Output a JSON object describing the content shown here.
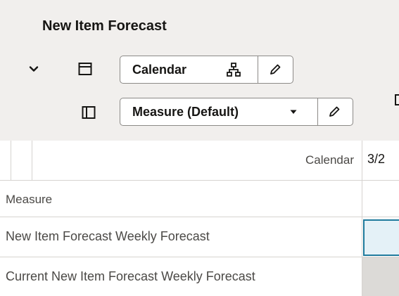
{
  "header": {
    "title": "New Item Forecast"
  },
  "pivot": {
    "column_chip": {
      "label": "Calendar"
    },
    "row_chip": {
      "label": "Measure (Default)"
    }
  },
  "grid": {
    "column_dimension_label": "Calendar",
    "first_column_header": "3/2",
    "row_dimension_label": "Measure",
    "rows": [
      {
        "label": "New Item Forecast Weekly Forecast"
      },
      {
        "label": "Current New Item Forecast Weekly Forecast"
      }
    ]
  },
  "colors": {
    "header_bg": "#f1efed",
    "grid_line": "#d6d3d0",
    "selected_cell_bg": "#e4f1f7",
    "selected_cell_border": "#1f7a9c",
    "readonly_cell_bg": "#dcdad7"
  }
}
